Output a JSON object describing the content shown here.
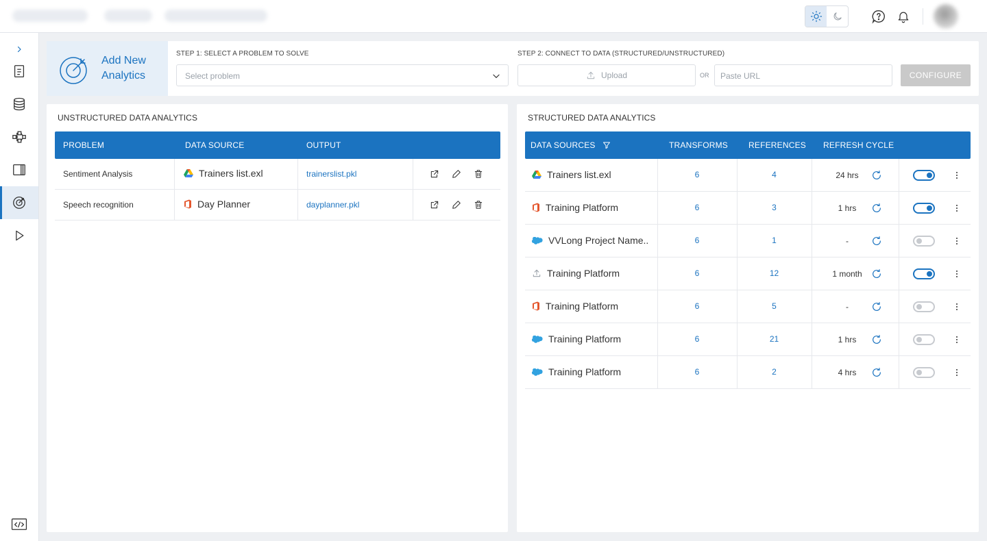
{
  "theme": {
    "accent": "#1b73c0",
    "active_mode": "light"
  },
  "topbar": {
    "icons": [
      "sun-icon",
      "moon-icon",
      "help-icon",
      "bell-icon",
      "avatar"
    ]
  },
  "sidebar": {
    "items": [
      {
        "name": "expand",
        "icon": "chevron-right-icon"
      },
      {
        "name": "documents",
        "icon": "document-icon"
      },
      {
        "name": "database",
        "icon": "database-icon"
      },
      {
        "name": "workflow",
        "icon": "workflow-icon"
      },
      {
        "name": "board",
        "icon": "board-icon"
      },
      {
        "name": "analytics",
        "icon": "target-icon",
        "active": true
      },
      {
        "name": "run",
        "icon": "play-icon"
      },
      {
        "name": "code",
        "icon": "code-icon"
      }
    ]
  },
  "add_analytics": {
    "title": "Add New Analytics",
    "step1_label": "STEP 1: SELECT A PROBLEM TO SOLVE",
    "select_placeholder": "Select problem",
    "step2_label": "STEP 2: CONNECT TO DATA (STRUCTURED/UNSTRUCTURED)",
    "upload_label": "Upload",
    "or_label": "OR",
    "url_placeholder": "Paste URL",
    "configure_label": "CONFIGURE"
  },
  "unstructured": {
    "title": "UNSTRUCTURED DATA ANALYTICS",
    "headers": {
      "problem": "PROBLEM",
      "data_source": "DATA SOURCE",
      "output": "OUTPUT"
    },
    "rows": [
      {
        "problem": "Sentiment Analysis",
        "source_icon": "google-drive-icon",
        "data_source": "Trainers list.exl",
        "output": "trainerslist.pkl"
      },
      {
        "problem": "Speech recognition",
        "source_icon": "office-icon",
        "data_source": "Day Planner",
        "output": "dayplanner.pkl"
      }
    ]
  },
  "structured": {
    "title": "STRUCTURED DATA ANALYTICS",
    "headers": {
      "data_sources": "DATA SOURCES",
      "transforms": "TRANSFORMS",
      "references": "REFERENCES",
      "refresh_cycle": "REFRESH CYCLE"
    },
    "rows": [
      {
        "source_icon": "google-drive-icon",
        "data_source": "Trainers list.exl",
        "transforms": "6",
        "references": "4",
        "refresh": "24 hrs",
        "enabled": true
      },
      {
        "source_icon": "office-icon",
        "data_source": "Training Platform",
        "transforms": "6",
        "references": "3",
        "refresh": "1 hrs",
        "enabled": true
      },
      {
        "source_icon": "salesforce-icon",
        "data_source": "VVLong Project Name..",
        "transforms": "6",
        "references": "1",
        "refresh": "-",
        "enabled": false
      },
      {
        "source_icon": "upload-icon",
        "data_source": "Training Platform",
        "transforms": "6",
        "references": "12",
        "refresh": "1 month",
        "enabled": true
      },
      {
        "source_icon": "office-icon",
        "data_source": "Training Platform",
        "transforms": "6",
        "references": "5",
        "refresh": "-",
        "enabled": false
      },
      {
        "source_icon": "salesforce-icon",
        "data_source": "Training Platform",
        "transforms": "6",
        "references": "21",
        "refresh": "1 hrs",
        "enabled": false
      },
      {
        "source_icon": "salesforce-icon",
        "data_source": "Training Platform",
        "transforms": "6",
        "references": "2",
        "refresh": "4 hrs",
        "enabled": false
      }
    ]
  }
}
